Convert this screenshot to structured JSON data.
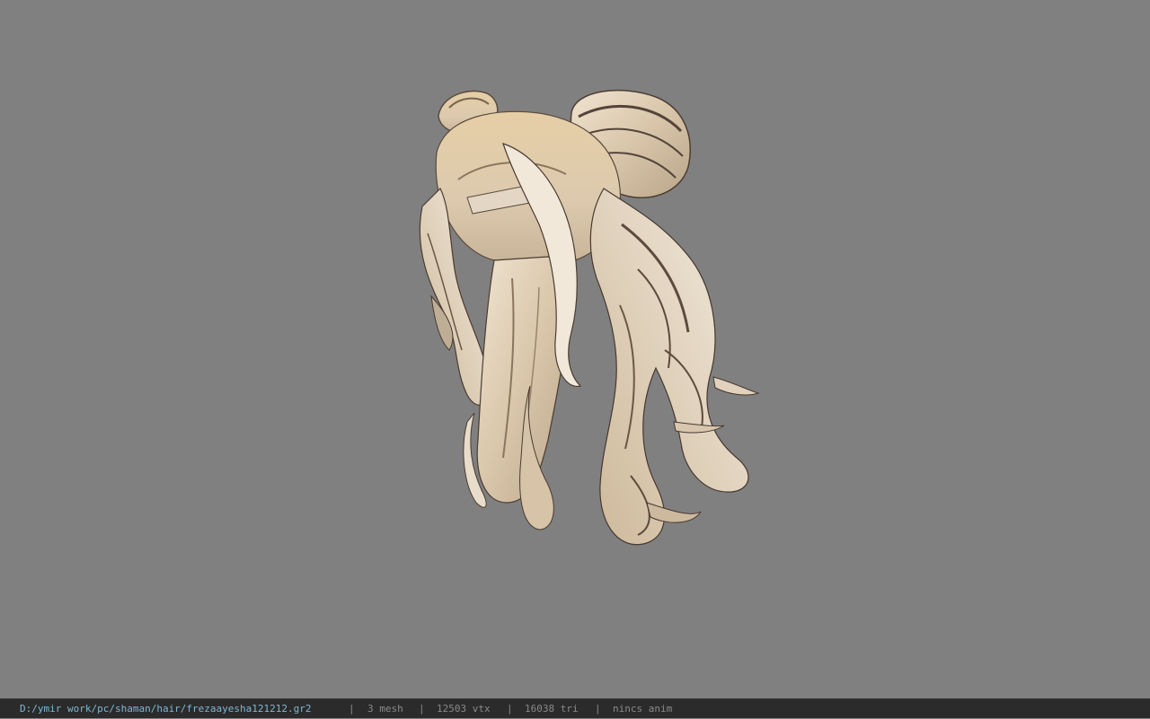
{
  "viewport": {
    "background": "#808080",
    "model_name": "hair mesh"
  },
  "statusbar": {
    "file_path": "D:/ymir work/pc/shaman/hair/frezaayesha121212.gr2",
    "separator": "|",
    "mesh": "3 mesh",
    "vtx": "12503 vtx",
    "tri": "16038 tri",
    "anim": "nincs anim",
    "path_color": "#7fb7d4",
    "text_color": "#8a8a8a",
    "background": "#2b2b2b"
  }
}
